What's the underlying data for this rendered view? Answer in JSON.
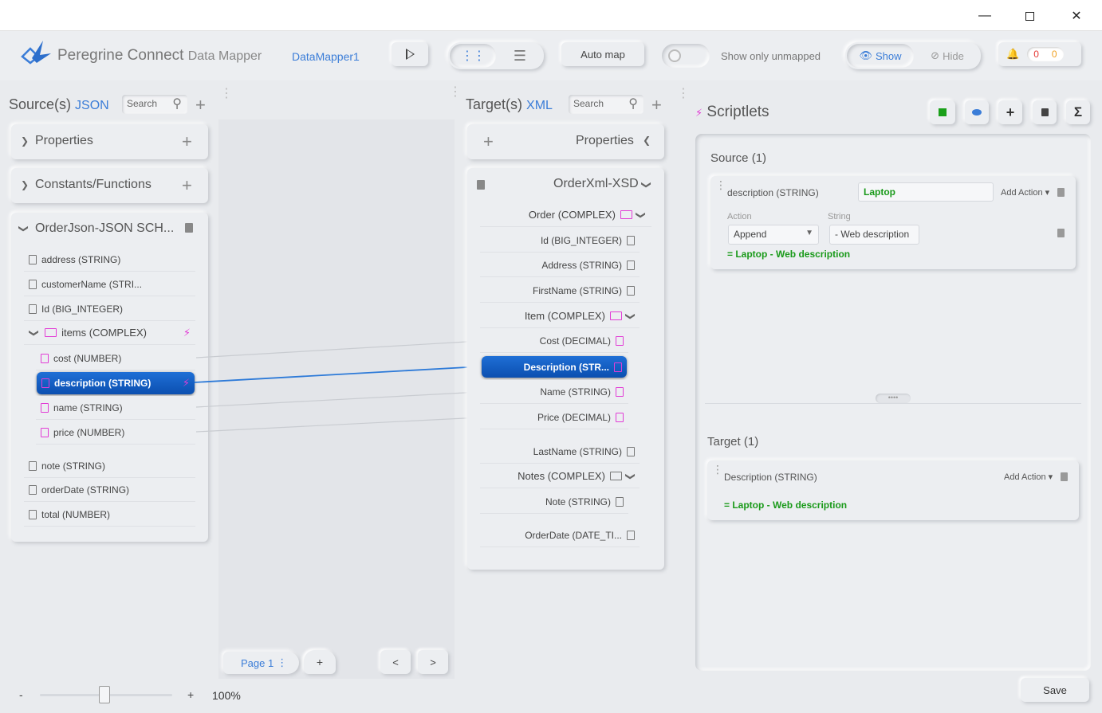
{
  "app": {
    "name_main": "Peregrine Connect",
    "name_sub": "Data Mapper",
    "document": "DataMapper1"
  },
  "toolbar": {
    "auto_map_label": "Auto map",
    "show_only_unmapped_label": "Show only unmapped",
    "show_label": "Show",
    "hide_label": "Hide",
    "notif_errors": "0",
    "notif_warnings": "0"
  },
  "source": {
    "title": "Source(s)",
    "format": "JSON",
    "search_placeholder": "Search",
    "properties_label": "Properties",
    "constants_label": "Constants/Functions",
    "schema_title": "OrderJson-JSON SCH...",
    "fields": [
      {
        "label": "address (STRING)"
      },
      {
        "label": "customerName (STRI..."
      },
      {
        "label": "Id (BIG_INTEGER)"
      },
      {
        "label": "items (COMPLEX)"
      },
      {
        "label": "cost (NUMBER)"
      },
      {
        "label": "description (STRING)"
      },
      {
        "label": "name (STRING)"
      },
      {
        "label": "price (NUMBER)"
      },
      {
        "label": "note (STRING)"
      },
      {
        "label": "orderDate (STRING)"
      },
      {
        "label": "total (NUMBER)"
      }
    ]
  },
  "target": {
    "title": "Target(s)",
    "format": "XML",
    "search_placeholder": "Search",
    "properties_label": "Properties",
    "schema_title": "OrderXml-XSD",
    "fields": [
      {
        "label": "Order (COMPLEX)"
      },
      {
        "label": "Id (BIG_INTEGER)"
      },
      {
        "label": "Address (STRING)"
      },
      {
        "label": "FirstName (STRING)"
      },
      {
        "label": "Item (COMPLEX)"
      },
      {
        "label": "Cost (DECIMAL)"
      },
      {
        "label": "Description (STR..."
      },
      {
        "label": "Name (STRING)"
      },
      {
        "label": "Price (DECIMAL)"
      },
      {
        "label": "LastName (STRING)"
      },
      {
        "label": "Notes (COMPLEX)"
      },
      {
        "label": "Note (STRING)"
      },
      {
        "label": "OrderDate (DATE_TI..."
      }
    ]
  },
  "mapping": {
    "page_label": "Page 1",
    "prev_label": "<",
    "next_label": ">",
    "add_label": "+"
  },
  "scriptlets": {
    "title": "Scriptlets",
    "source_header": "Source (1)",
    "source_field": "description (STRING)",
    "source_value": "Laptop",
    "add_action_label": "Add Action",
    "action_label": "Action",
    "string_label": "String",
    "action_value": "Append",
    "string_value": "- Web description",
    "source_result": "= Laptop - Web description",
    "target_header": "Target (1)",
    "target_field": "Description (STRING)",
    "target_result": "= Laptop - Web description"
  },
  "footer": {
    "zoom_minus": "-",
    "zoom_plus": "+",
    "zoom_value": "100%",
    "zoom_fraction": 0.49,
    "save_label": "Save"
  },
  "colors": {
    "accent": "#3b7dd8",
    "selected": "#0b4fb0",
    "bolt": "#e23cd6",
    "success": "#1a9a1a",
    "error": "#e53935",
    "warning": "#f0a020"
  }
}
